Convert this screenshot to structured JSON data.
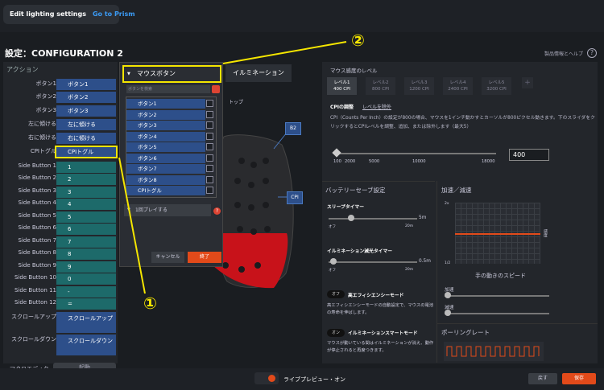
{
  "topbar": {
    "edit_label": "Edit lighting settings",
    "prism_label": "Go to Prism"
  },
  "page": {
    "title": "設定：CONFIGURATION 2",
    "help": "製品情報とヘルプ",
    "help_icon": "?"
  },
  "actions": {
    "header": "アクション",
    "rows": [
      {
        "label": "ボタン1",
        "value": "ボタン1"
      },
      {
        "label": "ボタン2",
        "value": "ボタン2"
      },
      {
        "label": "ボタン3",
        "value": "ボタン3"
      },
      {
        "label": "左に傾ける",
        "value": "左に傾ける"
      },
      {
        "label": "右に傾ける",
        "value": "右に傾ける"
      },
      {
        "label": "CPIトグル",
        "value": "CPIトグル"
      },
      {
        "label": "Side Button 1",
        "value": "1"
      },
      {
        "label": "Side Button 2",
        "value": "2"
      },
      {
        "label": "Side Button 3",
        "value": "3"
      },
      {
        "label": "Side Button 4",
        "value": "4"
      },
      {
        "label": "Side Button 5",
        "value": "5"
      },
      {
        "label": "Side Button 6",
        "value": "6"
      },
      {
        "label": "Side Button 7",
        "value": "7"
      },
      {
        "label": "Side Button 8",
        "value": "8"
      },
      {
        "label": "Side Button 9",
        "value": "9"
      },
      {
        "label": "Side Button 10",
        "value": "0"
      },
      {
        "label": "Side Button 11",
        "value": "-"
      },
      {
        "label": "Side Button 12",
        "value": "="
      },
      {
        "label": "スクロールアップ",
        "value": "スクロールアップ"
      },
      {
        "label": "スクロールダウン",
        "value": "スクロールダウン"
      }
    ],
    "macro_label": "マクロエディター",
    "macro_button": "起動"
  },
  "popup": {
    "selected": "マウスボタン",
    "search_placeholder": "ボタンを検索",
    "items": [
      "ボタン1",
      "ボタン2",
      "ボタン3",
      "ボタン4",
      "ボタン5",
      "ボタン6",
      "ボタン7",
      "ボタン8",
      "CPIトグル"
    ],
    "play_label": "1回プレイする",
    "help": "?",
    "cancel": "キャンセル",
    "ok": "終了"
  },
  "center": {
    "illumination_tab": "イルミネーション",
    "top_label": "トップ",
    "marker_b2": "B2",
    "marker_cpi": "CPI"
  },
  "annotations": {
    "one": "①",
    "two": "②"
  },
  "sensitivity": {
    "title": "マウス感度のレベル",
    "levels": [
      {
        "name": "レベル1",
        "cpi": "400 CPI"
      },
      {
        "name": "レベル2",
        "cpi": "800 CPI"
      },
      {
        "name": "レベル3",
        "cpi": "1200 CPI"
      },
      {
        "name": "レベル4",
        "cpi": "2400 CPI"
      },
      {
        "name": "レベル5",
        "cpi": "3200 CPI"
      }
    ],
    "plus": "+",
    "tab_adjust": "CPIの調整",
    "tab_exclude": "レベルを除外",
    "description": "CPI（Counts Per Inch）の設定が800の場合、マウスを1インチ動かすとカーソルが800ピクセル動きます。下のスライダをクリックするとCPIレベルを調整、追加、または除外します（最大5）",
    "ticks": [
      "100",
      "2000",
      "5000",
      "10000",
      "18000"
    ],
    "value": "400",
    "value_fraction": 0.0
  },
  "battery": {
    "title": "バッテリーセーブ設定",
    "sleep_label": "スリープタイマー",
    "sleep_min": "オフ",
    "sleep_max": "20m",
    "sleep_value": "5m",
    "illum_label": "イルミネーション減光タイマー",
    "illum_min": "オフ",
    "illum_max": "20m",
    "illum_value": "0.5m",
    "eco_toggle": "オフ",
    "eco_title": "高エフィシエンシーモード",
    "eco_desc": "高エフィシエンシーモードの自動設定で、マウスの電池の寿命を伸ばします。",
    "smart_toggle": "オン",
    "smart_title": "イルミネーションスマートモード",
    "smart_desc": "マウスが動いている間はイルミネーションが消え、動作が停止されると再度つきます。"
  },
  "accel": {
    "title": "加速／減速",
    "y_max": "2x",
    "y_min": "1/2",
    "side_label": "感度",
    "x_label": "手の動きのスピード",
    "accel_label": "加速",
    "decel_label": "減速",
    "polling_title": "ポーリングレート"
  },
  "bottom": {
    "live_preview": "ライブプレビュー・オン",
    "undo": "戻す",
    "save": "保存"
  },
  "colors": {
    "accent": "#e24a1a",
    "blue_button": "#2d4f8a",
    "teal_button": "#1d6a6a",
    "annotation": "#f5e600"
  }
}
